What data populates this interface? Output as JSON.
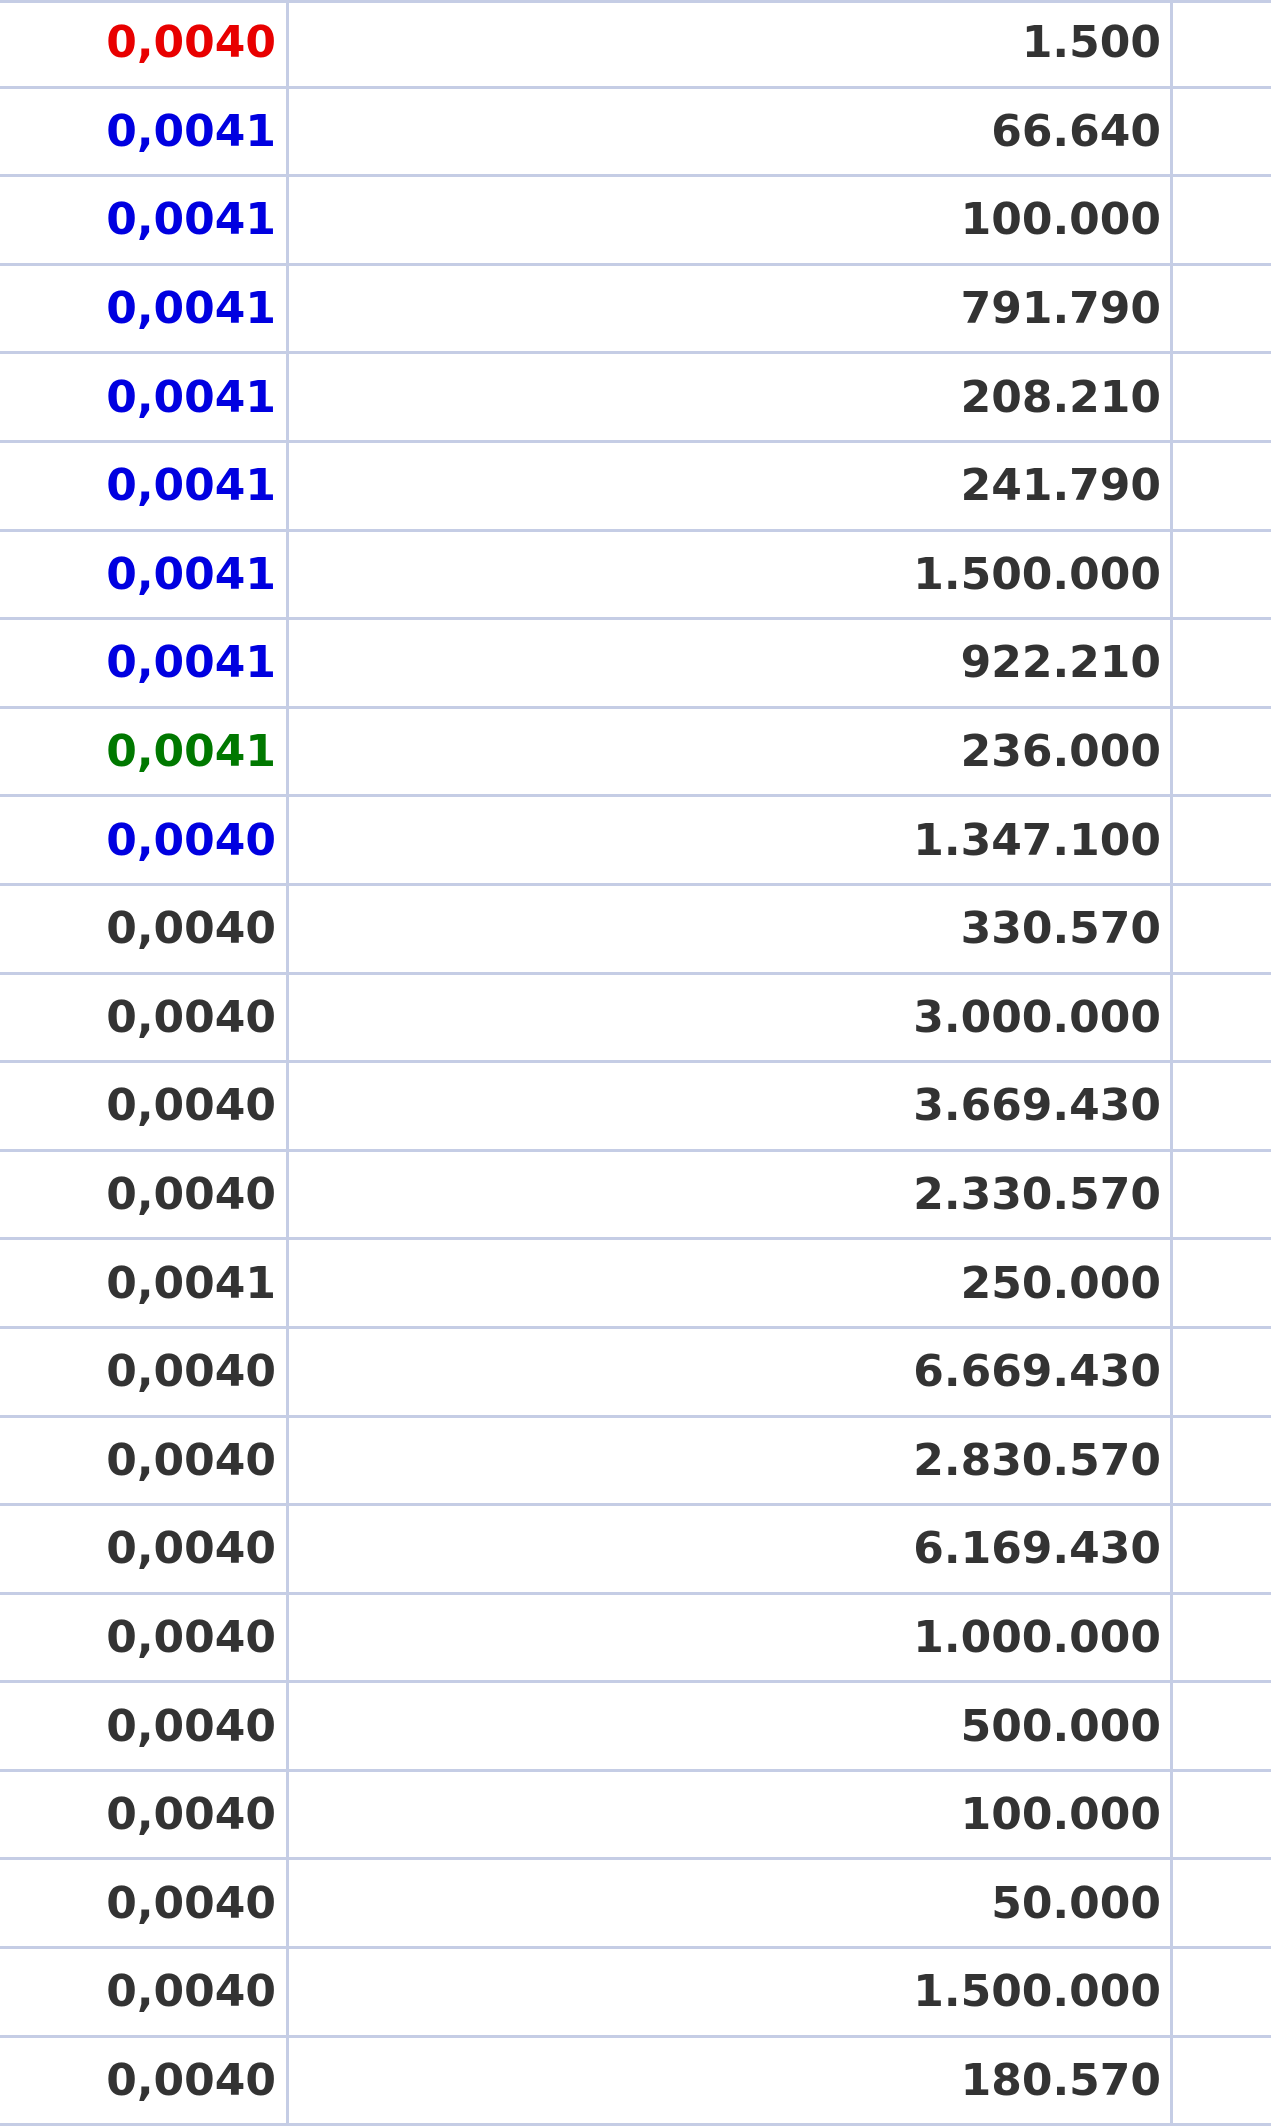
{
  "colors": {
    "red": "#e80000",
    "blue": "#0000e0",
    "green": "#007800",
    "gray": "#333333",
    "grid": "#c5cde5"
  },
  "rows": [
    {
      "price": "0,0040",
      "volume": "1.500",
      "price_color": "red"
    },
    {
      "price": "0,0041",
      "volume": "66.640",
      "price_color": "blue"
    },
    {
      "price": "0,0041",
      "volume": "100.000",
      "price_color": "blue"
    },
    {
      "price": "0,0041",
      "volume": "791.790",
      "price_color": "blue"
    },
    {
      "price": "0,0041",
      "volume": "208.210",
      "price_color": "blue"
    },
    {
      "price": "0,0041",
      "volume": "241.790",
      "price_color": "blue"
    },
    {
      "price": "0,0041",
      "volume": "1.500.000",
      "price_color": "blue"
    },
    {
      "price": "0,0041",
      "volume": "922.210",
      "price_color": "blue"
    },
    {
      "price": "0,0041",
      "volume": "236.000",
      "price_color": "green"
    },
    {
      "price": "0,0040",
      "volume": "1.347.100",
      "price_color": "blue"
    },
    {
      "price": "0,0040",
      "volume": "330.570",
      "price_color": "gray"
    },
    {
      "price": "0,0040",
      "volume": "3.000.000",
      "price_color": "gray"
    },
    {
      "price": "0,0040",
      "volume": "3.669.430",
      "price_color": "gray"
    },
    {
      "price": "0,0040",
      "volume": "2.330.570",
      "price_color": "gray"
    },
    {
      "price": "0,0041",
      "volume": "250.000",
      "price_color": "gray"
    },
    {
      "price": "0,0040",
      "volume": "6.669.430",
      "price_color": "gray"
    },
    {
      "price": "0,0040",
      "volume": "2.830.570",
      "price_color": "gray"
    },
    {
      "price": "0,0040",
      "volume": "6.169.430",
      "price_color": "gray"
    },
    {
      "price": "0,0040",
      "volume": "1.000.000",
      "price_color": "gray"
    },
    {
      "price": "0,0040",
      "volume": "500.000",
      "price_color": "gray"
    },
    {
      "price": "0,0040",
      "volume": "100.000",
      "price_color": "gray"
    },
    {
      "price": "0,0040",
      "volume": "50.000",
      "price_color": "gray"
    },
    {
      "price": "0,0040",
      "volume": "1.500.000",
      "price_color": "gray"
    },
    {
      "price": "0,0040",
      "volume": "180.570",
      "price_color": "gray"
    }
  ]
}
